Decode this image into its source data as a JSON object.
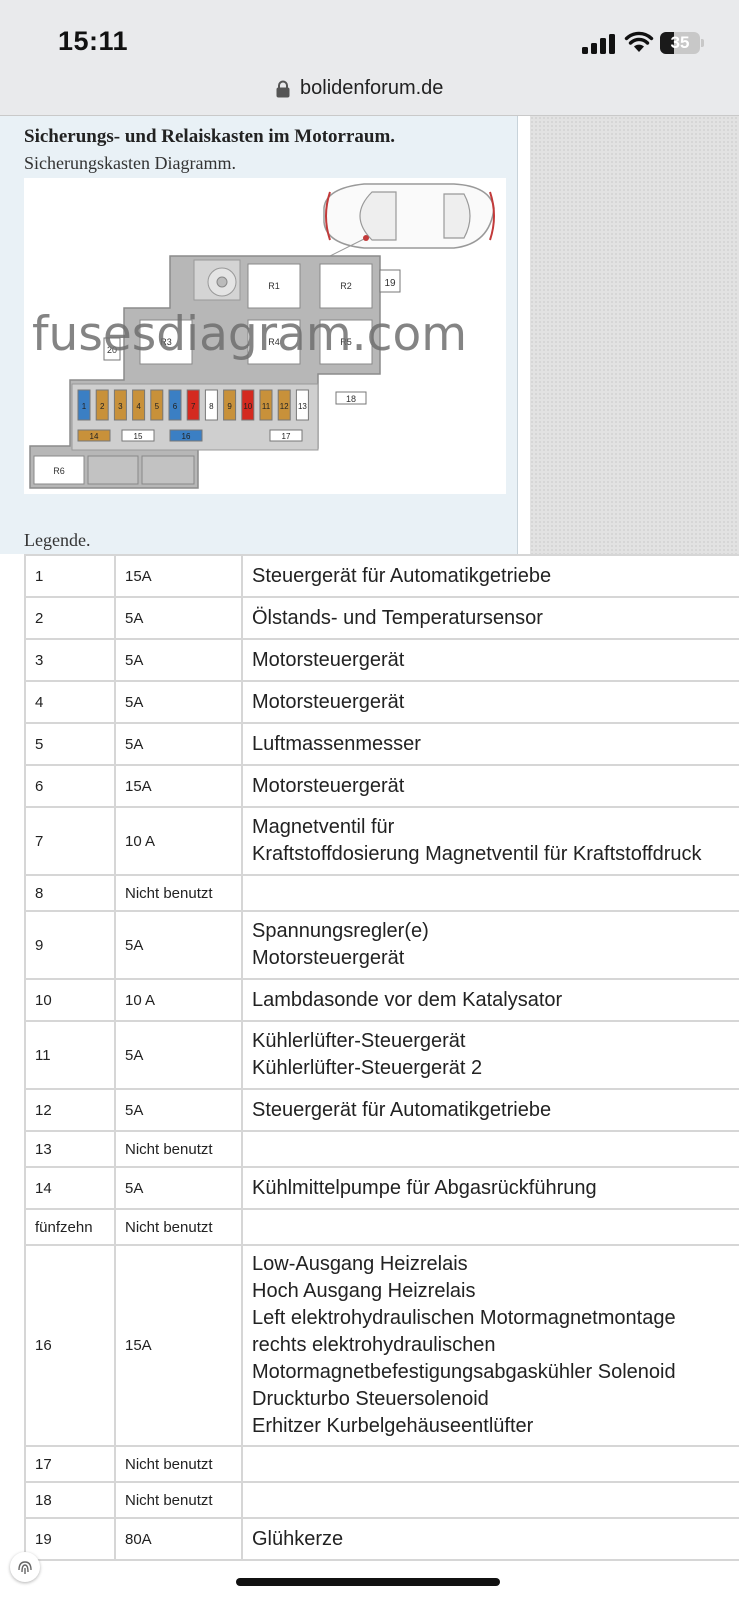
{
  "status": {
    "time": "15:11",
    "battery": "35",
    "battery_level_percent": 35
  },
  "browser": {
    "url": "bolidenforum.de"
  },
  "article": {
    "title": "Sicherungs- und Relaiskasten im Motorraum.",
    "subtitle": "Sicherungskasten Diagramm.",
    "legend": "Legende."
  },
  "diagram": {
    "watermark": "fusesdiagram.com",
    "relays": [
      "R1",
      "R2",
      "R3",
      "R4",
      "R5",
      "R6"
    ],
    "fuses": [
      {
        "n": "1",
        "color": "#3b7fc4"
      },
      {
        "n": "2",
        "color": "#c8913a"
      },
      {
        "n": "3",
        "color": "#c8913a"
      },
      {
        "n": "4",
        "color": "#c8913a"
      },
      {
        "n": "5",
        "color": "#c8913a"
      },
      {
        "n": "6",
        "color": "#3b7fc4"
      },
      {
        "n": "7",
        "color": "#d42a20"
      },
      {
        "n": "8",
        "color": "#ffffff"
      },
      {
        "n": "9",
        "color": "#c8913a"
      },
      {
        "n": "10",
        "color": "#d42a20"
      },
      {
        "n": "11",
        "color": "#c8913a"
      },
      {
        "n": "12",
        "color": "#c8913a"
      },
      {
        "n": "13",
        "color": "#ffffff"
      }
    ],
    "wide_fuses": [
      {
        "n": "14",
        "color": "#c8913a"
      },
      {
        "n": "15",
        "color": "#ffffff"
      },
      {
        "n": "16",
        "color": "#3b7fc4"
      },
      {
        "n": "17",
        "color": "#ffffff"
      }
    ],
    "labels": {
      "f18": "18",
      "f19": "19",
      "f20": "20"
    }
  },
  "table": {
    "rows": [
      {
        "num": "1",
        "amp": "15A",
        "desc": [
          "Steuergerät für Automatikgetriebe"
        ]
      },
      {
        "num": "2",
        "amp": "5A",
        "desc": [
          "Ölstands- und Temperatursensor"
        ]
      },
      {
        "num": "3",
        "amp": "5A",
        "desc": [
          "Motorsteuergerät"
        ]
      },
      {
        "num": "4",
        "amp": "5A",
        "desc": [
          "Motorsteuergerät"
        ]
      },
      {
        "num": "5",
        "amp": "5A",
        "desc": [
          "Luftmassenmesser"
        ]
      },
      {
        "num": "6",
        "amp": "15A",
        "desc": [
          "Motorsteuergerät"
        ]
      },
      {
        "num": "7",
        "amp": "10 A",
        "desc": [
          "Magnetventil für",
          "Kraftstoffdosierung Magnetventil für Kraftstoffdruck"
        ]
      },
      {
        "num": "8",
        "amp": "Nicht benutzt",
        "desc": []
      },
      {
        "num": "9",
        "amp": "5A",
        "desc": [
          "Spannungsregler(e)",
          "Motorsteuergerät"
        ]
      },
      {
        "num": "10",
        "amp": "10 A",
        "desc": [
          "Lambdasonde vor dem Katalysator"
        ]
      },
      {
        "num": "11",
        "amp": "5A",
        "desc": [
          "Kühlerlüfter-Steuergerät",
          "Kühlerlüfter-Steuergerät 2"
        ]
      },
      {
        "num": "12",
        "amp": "5A",
        "desc": [
          "Steuergerät für Automatikgetriebe"
        ]
      },
      {
        "num": "13",
        "amp": "Nicht benutzt",
        "desc": []
      },
      {
        "num": "14",
        "amp": "5A",
        "desc": [
          "Kühlmittelpumpe für Abgasrückführung"
        ]
      },
      {
        "num": "fünfzehn",
        "amp": "Nicht benutzt",
        "desc": []
      },
      {
        "num": "16",
        "amp": "15A",
        "desc": [
          "Low-Ausgang Heizrelais",
          "Hoch Ausgang Heizrelais",
          "Left elektrohydraulischen Motormagnetmontage",
          "rechts elektrohydraulischen",
          "Motormagnetbefestigungsabgaskühler Solenoid",
          "Druckturbo Steuersolenoid",
          "Erhitzer Kurbelgehäuseentlüfter"
        ]
      },
      {
        "num": "17",
        "amp": "Nicht benutzt",
        "desc": []
      },
      {
        "num": "18",
        "amp": "Nicht benutzt",
        "desc": []
      },
      {
        "num": "19",
        "amp": "80A",
        "desc": [
          "Glühkerze"
        ]
      }
    ]
  }
}
